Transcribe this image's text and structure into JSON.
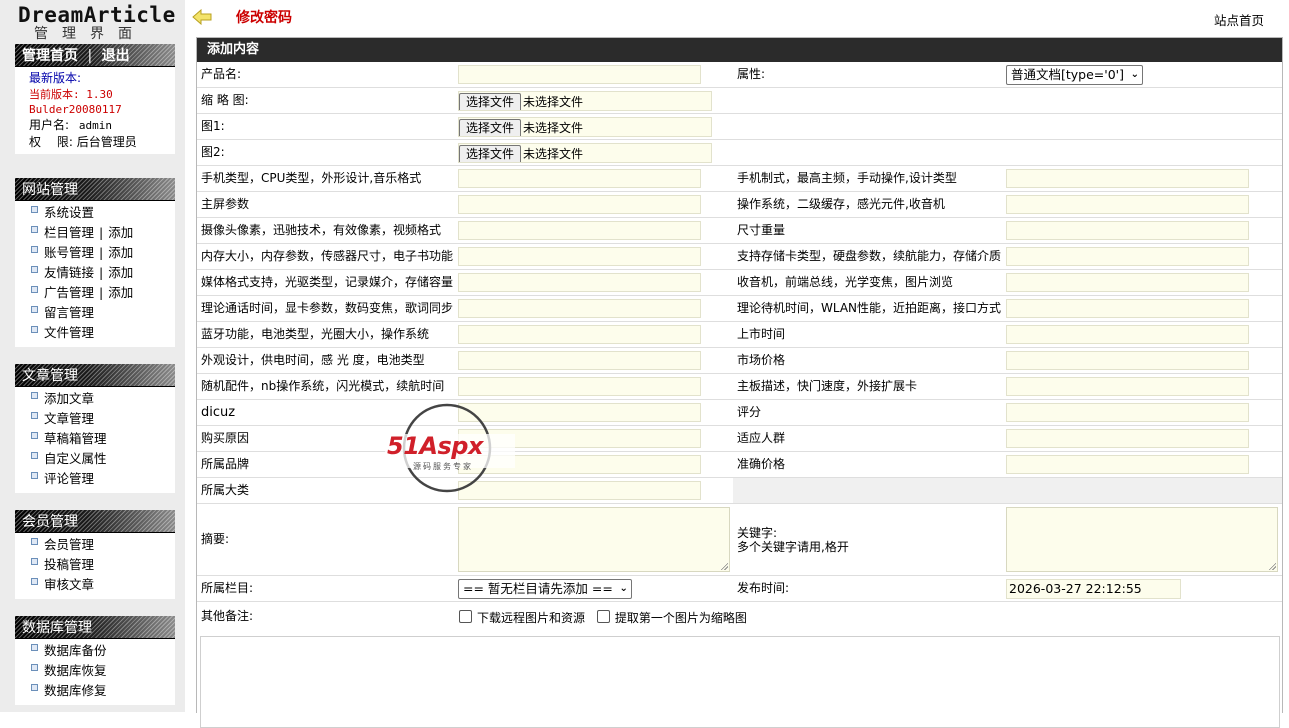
{
  "sidebar": {
    "logo_text": "DreamArticle",
    "logo_sub": "管理界面",
    "admin": {
      "home_link": "管理首页",
      "logout_link": "退出",
      "latest_version": "最新版本:",
      "current_version": "当前版本: 1.30",
      "build": "Bulder20080117",
      "username_label": "用户名:",
      "username": "admin",
      "role_label": "权　 限:",
      "role": "后台管理员"
    },
    "sections": [
      {
        "title": "网站管理",
        "items": [
          {
            "label": "系统设置"
          },
          {
            "label": "栏目管理",
            "add": "添加"
          },
          {
            "label": "账号管理",
            "add": "添加"
          },
          {
            "label": "友情链接",
            "add": "添加"
          },
          {
            "label": "广告管理",
            "add": "添加"
          },
          {
            "label": "留言管理"
          },
          {
            "label": "文件管理"
          }
        ]
      },
      {
        "title": "文章管理",
        "items": [
          {
            "label": "添加文章"
          },
          {
            "label": "文章管理"
          },
          {
            "label": "草稿箱管理"
          },
          {
            "label": "自定义属性"
          },
          {
            "label": "评论管理"
          }
        ]
      },
      {
        "title": "会员管理",
        "items": [
          {
            "label": "会员管理"
          },
          {
            "label": "投稿管理"
          },
          {
            "label": "审核文章"
          }
        ]
      },
      {
        "title": "数据库管理",
        "items": [
          {
            "label": "数据库备份"
          },
          {
            "label": "数据库恢复"
          },
          {
            "label": "数据库修复"
          }
        ]
      }
    ]
  },
  "topbar": {
    "change_password": "修改密码",
    "site_home": "站点首页"
  },
  "form": {
    "title": "添加内容",
    "product_name": "产品名:",
    "attribute": "属性:",
    "attribute_value": "普通文档[type='0']",
    "thumbnail": "缩 略 图:",
    "image1": "图1:",
    "image2": "图2:",
    "file_button": "选择文件",
    "file_none": "未选择文件",
    "pairs": [
      [
        "手机类型，CPU类型，外形设计,音乐格式",
        "手机制式，最高主频，手动操作,设计类型"
      ],
      [
        "主屏参数",
        "操作系统，二级缓存，感光元件,收音机"
      ],
      [
        "摄像头像素，迅驰技术，有效像素，视频格式",
        "尺寸重量"
      ],
      [
        "内存大小，内存参数，传感器尺寸，电子书功能",
        "支持存储卡类型，硬盘参数，续航能力，存储介质"
      ],
      [
        "媒体格式支持，光驱类型，记录媒介，存储容量",
        "收音机，前端总线，光学变焦，图片浏览"
      ],
      [
        "理论通话时间，显卡参数，数码变焦，歌词同步",
        "理论待机时间，WLAN性能，近拍距离，接口方式"
      ],
      [
        "蓝牙功能，电池类型，光圈大小，操作系统",
        "上市时间"
      ],
      [
        "外观设计，供电时间，感 光 度，电池类型",
        "市场价格"
      ],
      [
        "随机配件，nb操作系统，闪光模式，续航时间",
        "主板描述，快门速度，外接扩展卡"
      ],
      [
        "dicuz",
        "评分"
      ],
      [
        "购买原因",
        "适应人群"
      ],
      [
        "所属品牌",
        "准确价格"
      ]
    ],
    "category_big": "所属大类",
    "summary": "摘要:",
    "keywords": "关键字:",
    "keywords_hint": "多个关键字请用,格开",
    "column": "所属栏目:",
    "column_value": "== 暂无栏目请先添加 ==",
    "publish_time": "发布时间:",
    "publish_value": "2026-03-27 22:12:55",
    "other_notes": "其他备注:",
    "download_remote": "下载远程图片和资源",
    "first_as_thumb": "提取第一个图片为缩略图"
  },
  "watermark": {
    "brand": "51Aspx",
    "sub": "源码服务专家"
  }
}
